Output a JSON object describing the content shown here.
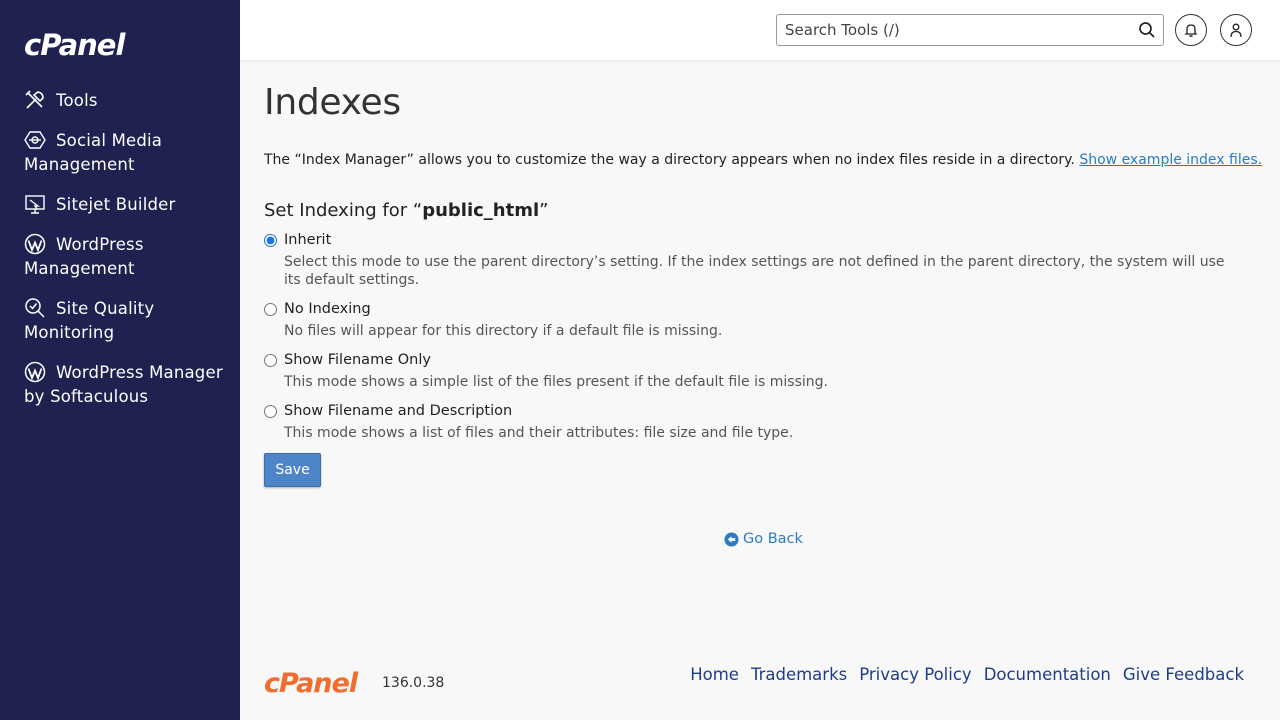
{
  "sidebar": {
    "logo": "cPanel",
    "items": [
      {
        "label": "Tools",
        "icon": "tools-icon"
      },
      {
        "label": "Social Media Management",
        "icon": "social-media-icon"
      },
      {
        "label": "Sitejet Builder",
        "icon": "sitejet-icon"
      },
      {
        "label": "WordPress Management",
        "icon": "wordpress-icon"
      },
      {
        "label": "Site Quality Monitoring",
        "icon": "site-quality-icon"
      },
      {
        "label": "WordPress Manager by Softaculous",
        "icon": "wordpress-icon"
      }
    ]
  },
  "header": {
    "search_placeholder": "Search Tools (/)"
  },
  "main": {
    "title": "Indexes",
    "description": "The “Index Manager” allows you to customize the way a directory appears when no index files reside in a directory.",
    "description_link": "Show example index files.",
    "section_prefix": "Set Indexing for “",
    "section_dir": "public_html",
    "section_suffix": "”",
    "options": [
      {
        "label": "Inherit",
        "help": "Select this mode to use the parent directory’s setting. If the index settings are not defined in the parent directory, the system will use its default settings.",
        "selected": true
      },
      {
        "label": "No Indexing",
        "help": "No files will appear for this directory if a default file is missing.",
        "selected": false
      },
      {
        "label": "Show Filename Only",
        "help": "This mode shows a simple list of the files present if the default file is missing.",
        "selected": false
      },
      {
        "label": "Show Filename and Description",
        "help": "This mode shows a list of files and their attributes: file size and file type.",
        "selected": false
      }
    ],
    "save_label": "Save",
    "go_back_label": "Go Back"
  },
  "footer": {
    "logo": "cPanel",
    "version": "136.0.38",
    "links": [
      "Home",
      "Trademarks",
      "Privacy Policy",
      "Documentation",
      "Give Feedback"
    ]
  },
  "colors": {
    "sidebar_bg": "#1f2150",
    "link": "#2c7bc3",
    "footer_logo": "#f26c2e",
    "button": "#4e85c8"
  }
}
